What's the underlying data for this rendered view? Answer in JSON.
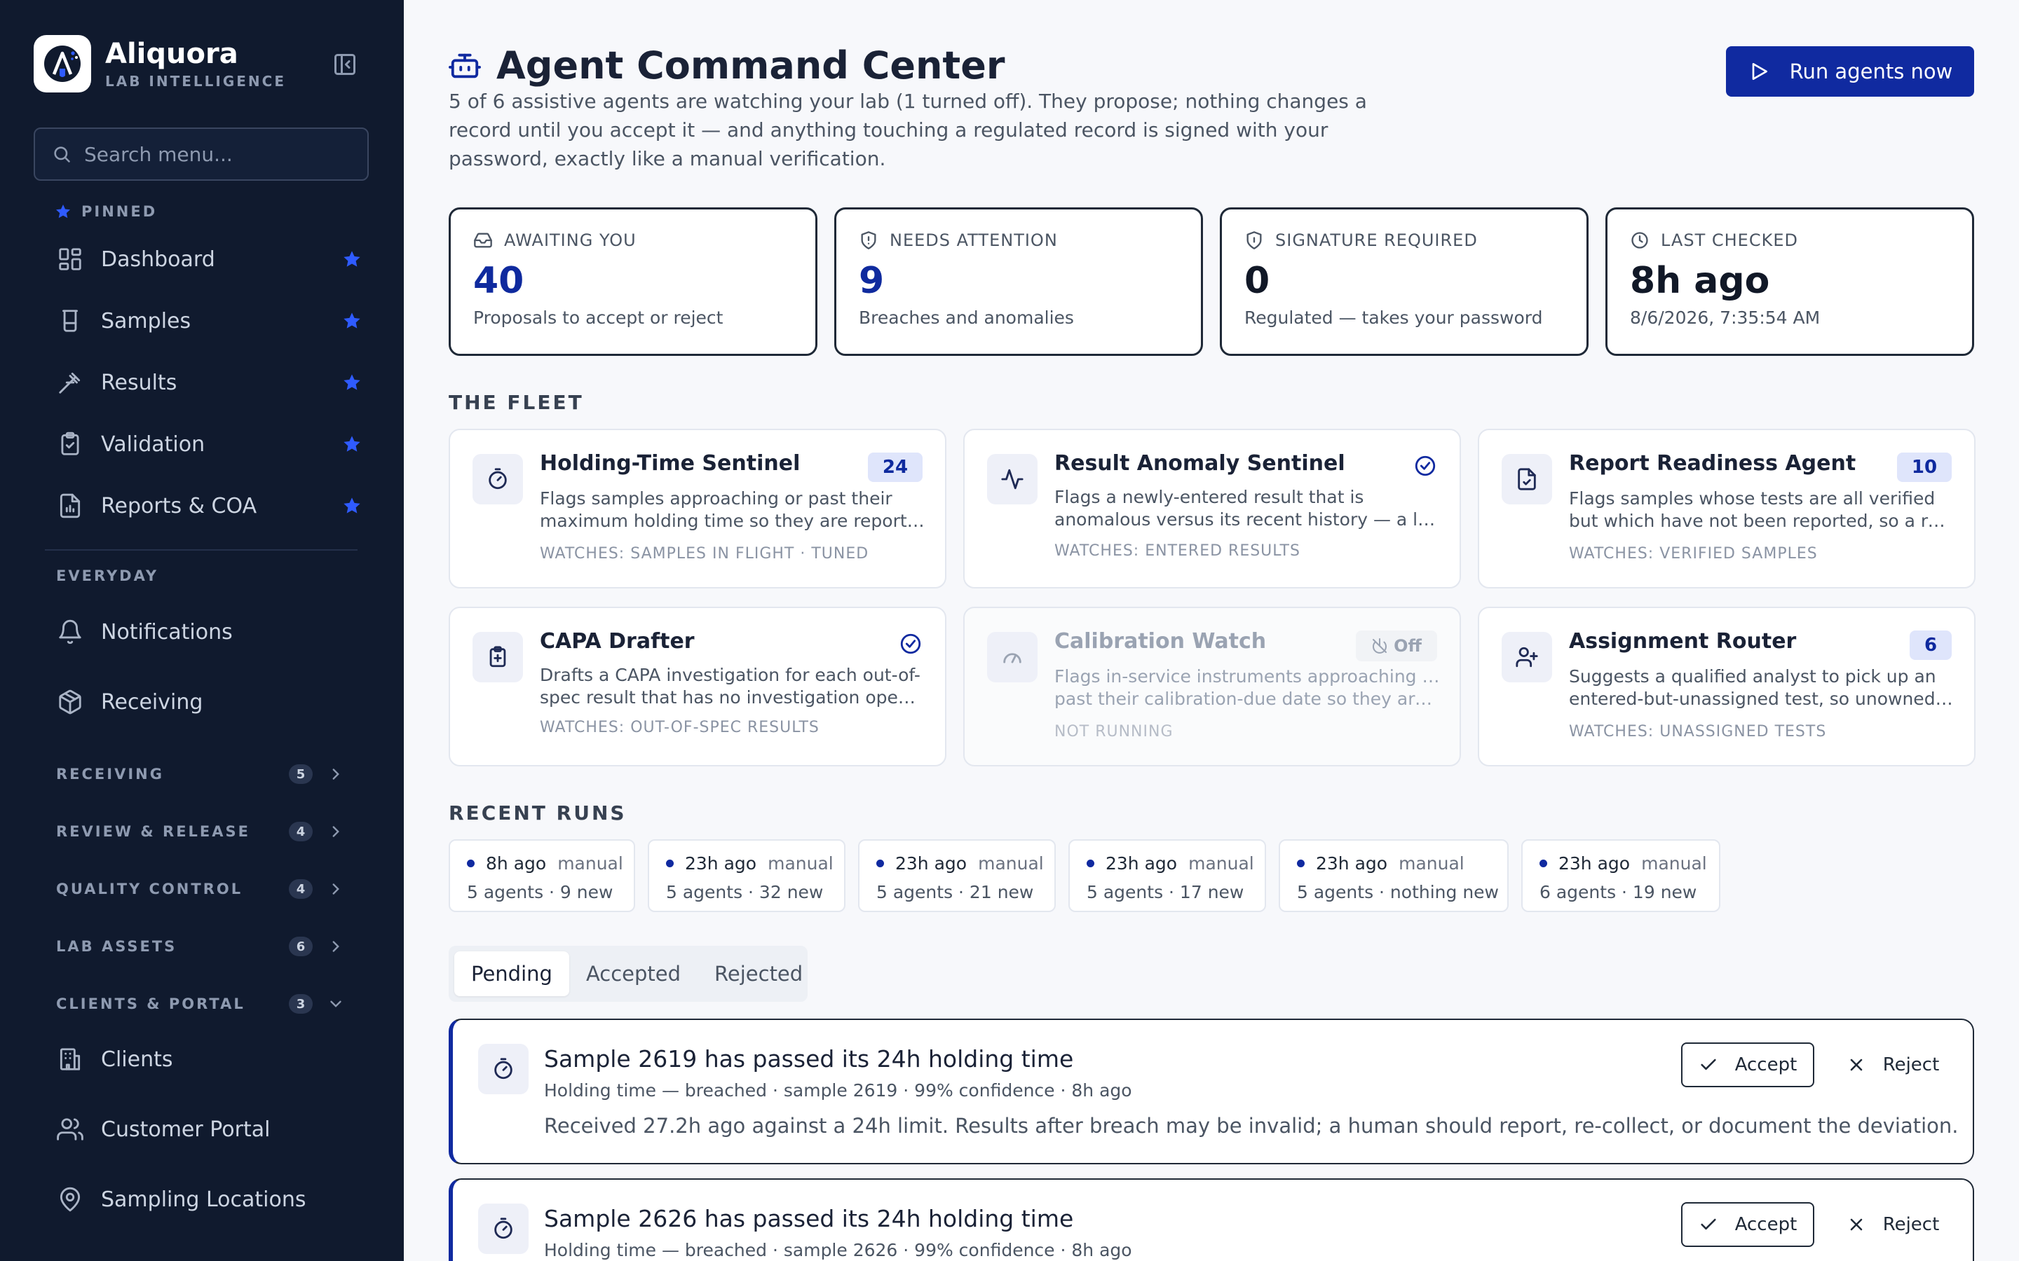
{
  "brand": {
    "name": "Aliquora",
    "subtitle": "LAB INTELLIGENCE"
  },
  "sidebar": {
    "search_placeholder": "Search menu...",
    "pinned_label": "PINNED",
    "pinned": [
      {
        "label": "Dashboard",
        "icon": "dashboard-icon"
      },
      {
        "label": "Samples",
        "icon": "beaker-icon"
      },
      {
        "label": "Results",
        "icon": "pipette-icon"
      },
      {
        "label": "Validation",
        "icon": "clipboard-check-icon"
      },
      {
        "label": "Reports & COA",
        "icon": "report-icon"
      }
    ],
    "everyday_label": "EVERYDAY",
    "everyday": [
      {
        "label": "Notifications",
        "icon": "bell-icon"
      },
      {
        "label": "Receiving",
        "icon": "package-icon"
      }
    ],
    "groups": [
      {
        "label": "RECEIVING",
        "count": "5",
        "expanded": false
      },
      {
        "label": "REVIEW & RELEASE",
        "count": "4",
        "expanded": false
      },
      {
        "label": "QUALITY CONTROL",
        "count": "4",
        "expanded": false
      },
      {
        "label": "LAB ASSETS",
        "count": "6",
        "expanded": false
      },
      {
        "label": "CLIENTS & PORTAL",
        "count": "3",
        "expanded": true
      }
    ],
    "client_items": [
      {
        "label": "Clients",
        "icon": "building-icon"
      },
      {
        "label": "Customer Portal",
        "icon": "users-icon"
      },
      {
        "label": "Sampling Locations",
        "icon": "map-pin-icon"
      }
    ]
  },
  "header": {
    "title": "Agent Command Center",
    "description": "5 of 6 assistive agents are watching your lab (1 turned off). They propose; nothing changes a record until you accept it — and anything touching a regulated record is signed with your password, exactly like a manual verification.",
    "run_button": "Run agents now"
  },
  "stats": [
    {
      "label": "AWAITING YOU",
      "value": "40",
      "note": "Proposals to accept or reject",
      "icon": "inbox-icon"
    },
    {
      "label": "NEEDS ATTENTION",
      "value": "9",
      "note": "Breaches and anomalies",
      "icon": "shield-alert-icon"
    },
    {
      "label": "SIGNATURE REQUIRED",
      "value": "0",
      "note": "Regulated — takes your password",
      "icon": "shield-icon"
    },
    {
      "label": "LAST CHECKED",
      "value": "8h ago",
      "note": "8/6/2026, 7:35:54 AM",
      "icon": "clock-icon"
    }
  ],
  "fleet": {
    "title": "THE FLEET",
    "agents": [
      {
        "name": "Holding-Time Sentinel",
        "desc1": "Flags samples approaching or past their",
        "desc2": "maximum holding time so they are reported in time.",
        "watches": "WATCHES: SAMPLES IN FLIGHT · TUNED",
        "badge": "24",
        "status": "count",
        "icon": "timer-icon"
      },
      {
        "name": "Result Anomaly Sentinel",
        "desc1": "Flags a newly-entered result that is",
        "desc2": "anomalous versus its recent history — a likely error.",
        "watches": "WATCHES: ENTERED RESULTS",
        "badge": "",
        "status": "clear",
        "icon": "activity-icon"
      },
      {
        "name": "Report Readiness Agent",
        "desc1": "Flags samples whose tests are all verified",
        "desc2": "but which have not been reported, so a report is drafted.",
        "watches": "WATCHES: VERIFIED SAMPLES",
        "badge": "10",
        "status": "count",
        "icon": "file-check-icon"
      },
      {
        "name": "CAPA Drafter",
        "desc1": "Drafts a CAPA investigation for each out-of-",
        "desc2": "spec result that has no investigation open yet.",
        "watches": "WATCHES: OUT-OF-SPEC RESULTS",
        "badge": "",
        "status": "clear",
        "icon": "clipboard-plus-icon"
      },
      {
        "name": "Calibration Watch",
        "desc1": "Flags in-service instruments approaching or",
        "desc2": "past their calibration-due date so they are recalibrated.",
        "watches": "NOT RUNNING",
        "badge": "Off",
        "status": "off",
        "icon": "gauge-icon"
      },
      {
        "name": "Assignment Router",
        "desc1": "Suggests a qualified analyst to pick up an",
        "desc2": "entered-but-unassigned test, so unowned work is routed.",
        "watches": "WATCHES: UNASSIGNED TESTS",
        "badge": "6",
        "status": "count",
        "icon": "user-plus-icon"
      }
    ]
  },
  "recent_runs": {
    "title": "RECENT RUNS",
    "runs": [
      {
        "when": "8h ago",
        "kind": "manual",
        "summary": "5 agents · 9 new"
      },
      {
        "when": "23h ago",
        "kind": "manual",
        "summary": "5 agents · 32 new"
      },
      {
        "when": "23h ago",
        "kind": "manual",
        "summary": "5 agents · 21 new"
      },
      {
        "when": "23h ago",
        "kind": "manual",
        "summary": "5 agents · 17 new"
      },
      {
        "when": "23h ago",
        "kind": "manual",
        "summary": "5 agents · nothing new"
      },
      {
        "when": "23h ago",
        "kind": "manual",
        "summary": "6 agents · 19 new"
      }
    ]
  },
  "tabs": [
    {
      "label": "Pending",
      "active": true
    },
    {
      "label": "Accepted",
      "active": false
    },
    {
      "label": "Rejected",
      "active": false
    }
  ],
  "proposals": [
    {
      "title": "Sample 2619 has passed its 24h holding time",
      "meta": "Holding time — breached · sample 2619 · 99% confidence · 8h ago",
      "body": "Received 27.2h ago against a 24h limit. Results after breach may be invalid; a human should report, re-collect, or document the deviation.",
      "accept": "Accept",
      "reject": "Reject"
    },
    {
      "title": "Sample 2626 has passed its 24h holding time",
      "meta": "Holding time — breached · sample 2626 · 99% confidence · 8h ago",
      "body": "",
      "accept": "Accept",
      "reject": "Reject"
    }
  ],
  "colors": {
    "sidebar_bg": "#101a2e",
    "accent": "#102aa0",
    "star": "#2f5bff",
    "page_bg": "#f7f8fb"
  }
}
